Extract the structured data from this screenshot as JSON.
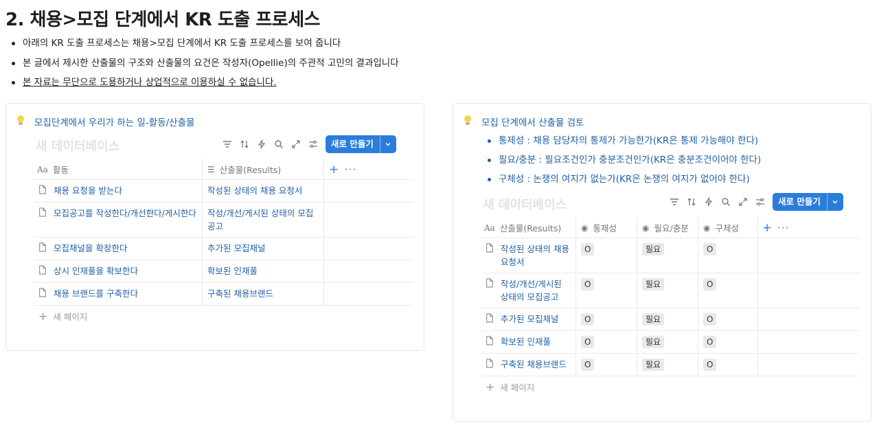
{
  "heading": "2. 채용>모집 단계에서 KR 도출 프로세스",
  "bullets": [
    "아래의 KR 도출 프로세스는 채용>모집 단계에서 KR 도출 프로세스를 보여 줍니다",
    "본 글에서 제시한 산출물의 구조와 산출물의 요건은 작성자(Opellie)의 주관적 고민의 결과입니다",
    "본 자료는 무단으로 도용하거나 상업적으로 이용하실 수 없습니다."
  ],
  "left": {
    "callout_icon": "lightbulb-icon",
    "title": "모집단계에서 우리가 하는 일-활동/산출물",
    "db_title": "새 데이터베이스",
    "new_button": "새로 만들기",
    "headers": {
      "activity": "활동",
      "output": "산출물(Results)"
    },
    "rows": [
      {
        "activity": "채용 요청을 받는다",
        "output": "작성된 상태의 채용 요청서"
      },
      {
        "activity": "모집공고를 작성한다/개선한다/게시한다",
        "output": "작성/개선/게시된 상태의 모집공고"
      },
      {
        "activity": "모집채널을 확장한다",
        "output": "추가된 모집채널"
      },
      {
        "activity": "상시 인재풀을 확보한다",
        "output": "확보된 인재풀"
      },
      {
        "activity": "채용 브랜드를 구축한다",
        "output": "구축된 채용브랜드"
      }
    ],
    "new_page": "새 페이지"
  },
  "right": {
    "callout_icon": "lightbulb-icon",
    "title": "모집 단계에서 산출물 검토",
    "bullets": [
      "통제성 : 채용 담당자의 통제가 가능한가(KR은 통제 가능해야 한다)",
      "필요/충분 : 필요조건인가 충분조건인가(KR은 충분조건이어야 한다)",
      "구체성 : 논쟁의 여지가 없는가(KR은 논쟁의 여지가 없어야 한다)"
    ],
    "db_title": "새 데이터베이스",
    "new_button": "새로 만들기",
    "headers": {
      "output": "산출물(Results)",
      "control": "통제성",
      "need": "필요/충분",
      "spec": "구체성"
    },
    "rows": [
      {
        "output": "작성된 상태의 채용 요청서",
        "control": "O",
        "need": "필요",
        "spec": "O"
      },
      {
        "output": "작성/개선/게시된 상태의 모집공고",
        "control": "O",
        "need": "필요",
        "spec": "O"
      },
      {
        "output": "추가된 모집채널",
        "control": "O",
        "need": "필요",
        "spec": "O"
      },
      {
        "output": "확보된 인재풀",
        "control": "O",
        "need": "필요",
        "spec": "O"
      },
      {
        "output": "구축된 채용브랜드",
        "control": "O",
        "need": "필요",
        "spec": "O"
      }
    ],
    "new_page": "새 페이지"
  },
  "toolbar_icons": [
    "filter-icon",
    "sort-icon",
    "automation-icon",
    "search-icon",
    "expand-icon",
    "settings-icon"
  ],
  "colors": {
    "accent": "#2b7ddb",
    "link": "#1f5fa6",
    "tag_bg": "#e9e9e7",
    "border": "#e6e5e3"
  }
}
